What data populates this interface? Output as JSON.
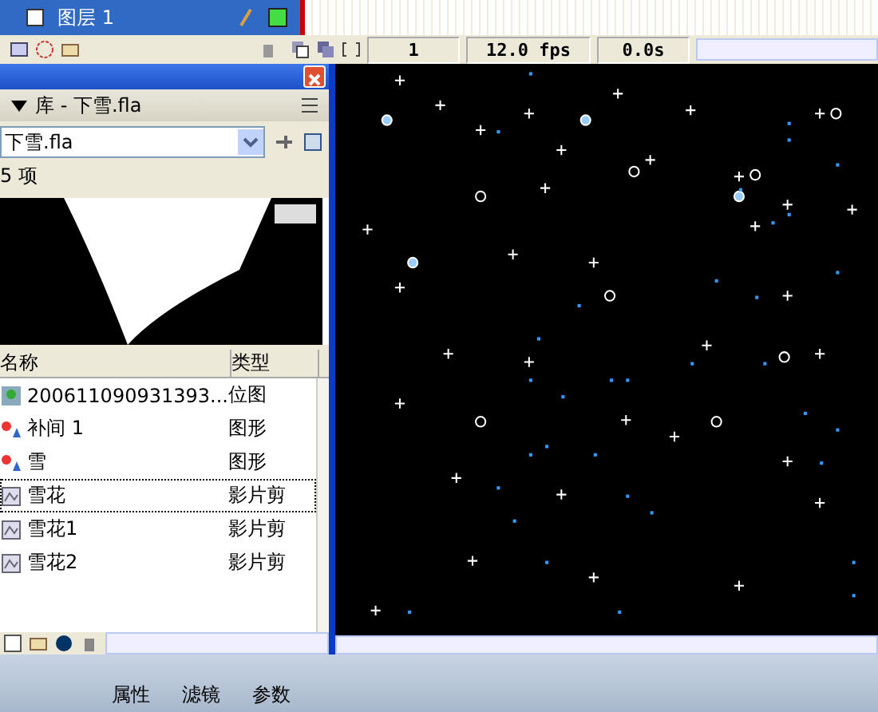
{
  "layers": [
    {
      "name": "图层 1",
      "selected": true
    }
  ],
  "timeline": {
    "frame": "1",
    "fps": "12.0 fps",
    "time": "0.0s"
  },
  "library": {
    "title": "库 - 下雪.fla",
    "document": "下雪.fla",
    "count": "5 项",
    "columns": [
      "名称",
      "类型"
    ],
    "items": [
      {
        "name": "200611090931393...",
        "type": "位图",
        "kind": "bitmap",
        "focused": false
      },
      {
        "name": "补间 1",
        "type": "图形",
        "kind": "graphic",
        "focused": false
      },
      {
        "name": "雪",
        "type": "图形",
        "kind": "graphic",
        "focused": false
      },
      {
        "name": "雪花",
        "type": "影片剪",
        "kind": "movieclip",
        "focused": true
      },
      {
        "name": "雪花1",
        "type": "影片剪",
        "kind": "movieclip",
        "focused": false
      },
      {
        "name": "雪花2",
        "type": "影片剪",
        "kind": "movieclip",
        "focused": false
      }
    ]
  },
  "tabs": [
    {
      "label": "属性"
    },
    {
      "label": "滤镜"
    },
    {
      "label": "参数"
    }
  ]
}
